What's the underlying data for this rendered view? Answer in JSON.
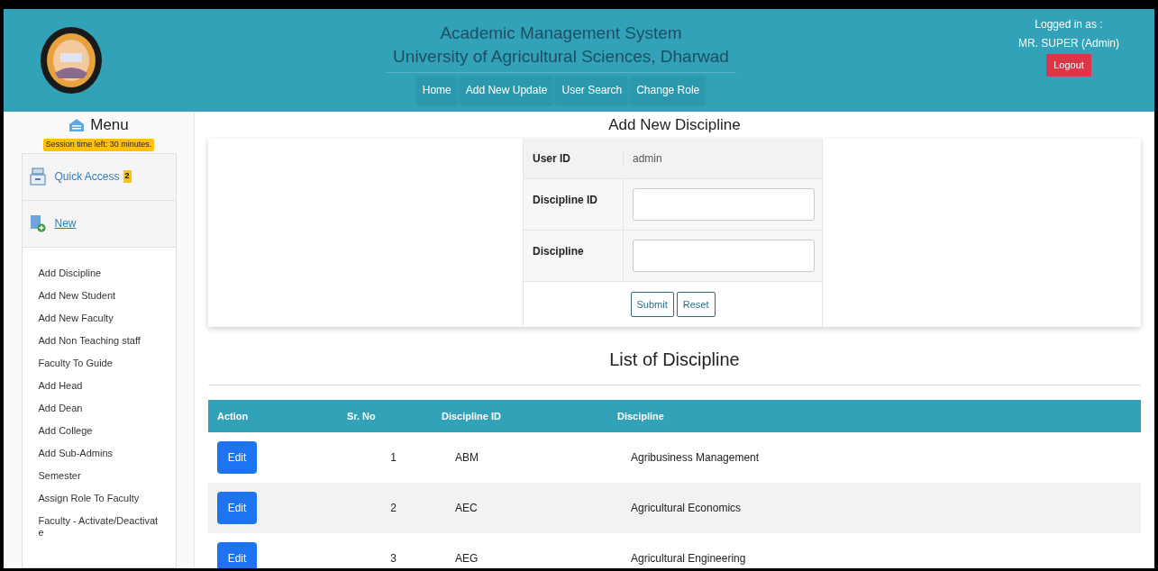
{
  "header": {
    "title_lines": [
      "Academic Management System",
      "University of Agricultural Sciences, Dharwad"
    ],
    "nav": [
      {
        "label": "Home"
      },
      {
        "label": "Add New Update"
      },
      {
        "label": "User Search"
      },
      {
        "label": "Change Role"
      }
    ],
    "login_label": "Logged in as :",
    "user": "MR. SUPER (Admin)",
    "logout": "Logout"
  },
  "sidebar": {
    "title": "Menu",
    "session": "Session time left: 30 minutes.",
    "sections": [
      {
        "kind": "quick",
        "label": "Quick Access",
        "badge": "2"
      },
      {
        "kind": "new",
        "label": "New"
      }
    ],
    "items": [
      "Add Discipline",
      "Add New Student",
      "Add New Faculty",
      "Add Non Teaching staff",
      "Faculty To Guide",
      "Add Head",
      "Add Dean",
      "Add College",
      "Add Sub-Admins",
      "Semester",
      "Assign Role To Faculty",
      "Faculty - Activate/Deactivat e"
    ]
  },
  "form": {
    "title": "Add New Discipline",
    "fields": [
      {
        "kind": "static",
        "label": "User ID",
        "value": "admin"
      },
      {
        "kind": "input",
        "label": "Discipline ID"
      },
      {
        "kind": "input",
        "label": "Discipline"
      }
    ],
    "buttons": [
      "Submit",
      "Reset"
    ]
  },
  "list": {
    "title": "List of Discipline",
    "columns": [
      "Action",
      "Sr. No",
      "Discipline ID",
      "Discipline"
    ],
    "rows": [
      {
        "action": "Edit",
        "sr": "1",
        "id": "ABM",
        "discipline": "Agribusiness Management"
      },
      {
        "action": "Edit",
        "sr": "2",
        "id": "AEC",
        "discipline": "Agricultural Economics"
      },
      {
        "action": "Edit",
        "sr": "3",
        "id": "AEG",
        "discipline": "Agricultural Engineering"
      }
    ]
  }
}
